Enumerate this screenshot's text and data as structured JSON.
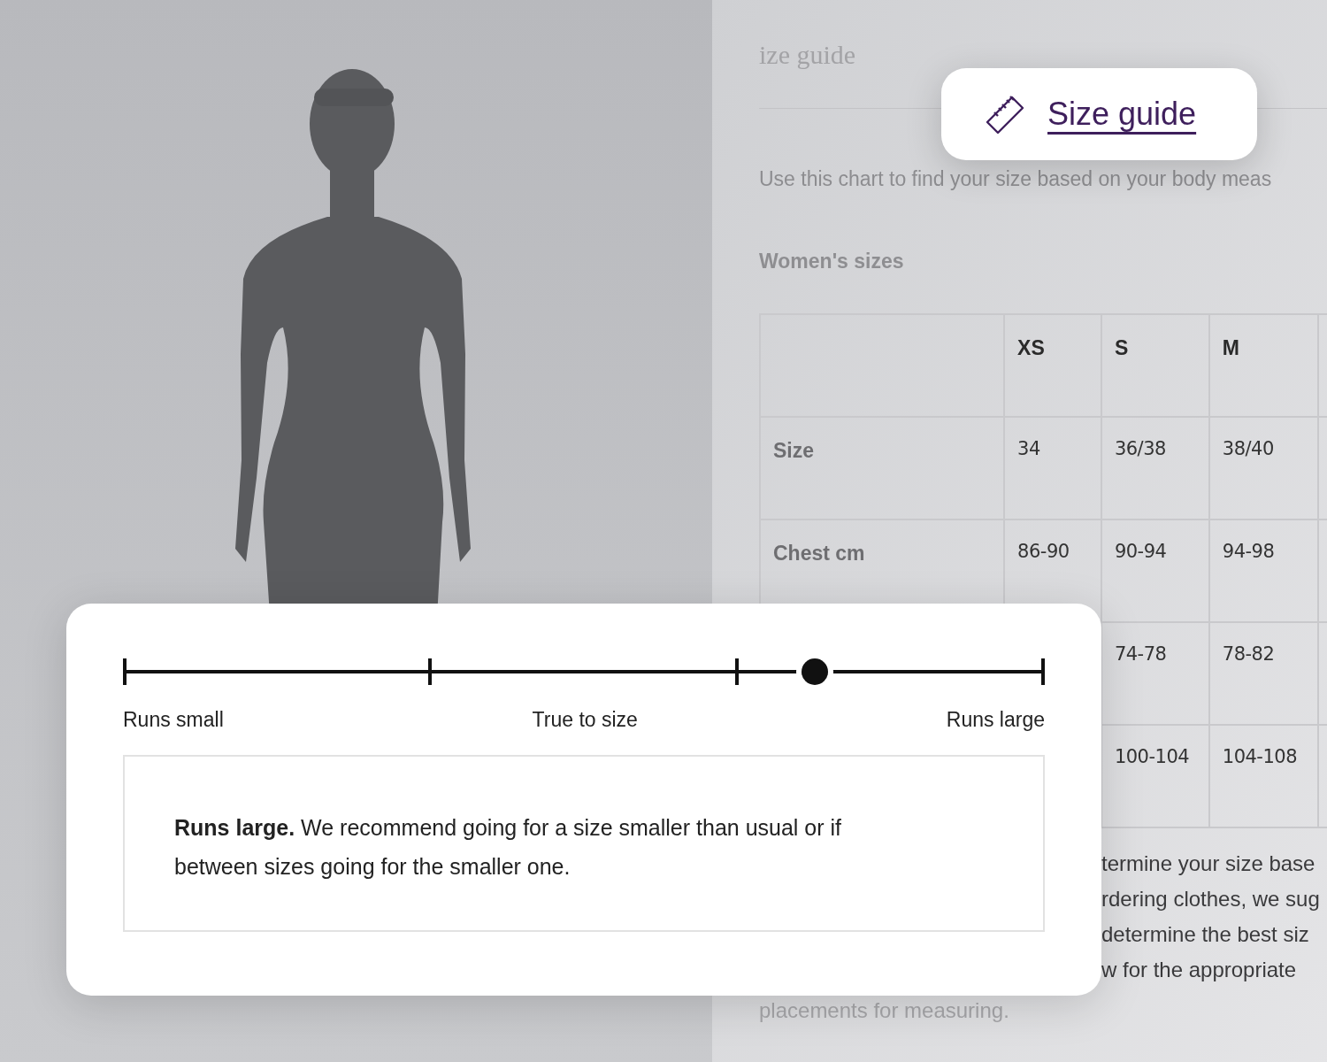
{
  "guide": {
    "title": "ize guide",
    "intro": "Use this chart to find your size based on your body meas",
    "section_title": "Women's sizes"
  },
  "table": {
    "columns": [
      "XS",
      "S",
      "M"
    ],
    "rows": [
      {
        "label": "Size",
        "cells": [
          "34",
          "36/38",
          "38/40"
        ]
      },
      {
        "label": "Chest cm",
        "cells": [
          "86-90",
          "90-94",
          "94-98"
        ]
      },
      {
        "cells": [
          "74-78",
          "78-82"
        ]
      },
      {
        "cells": [
          "100-104",
          "104-108"
        ]
      }
    ]
  },
  "notes": [
    "termine your size base",
    "rdering clothes, we sug",
    "determine the best siz",
    "w for the appropriate",
    "placements for measuring."
  ],
  "size_guide_link": {
    "label": "Size guide"
  },
  "fit": {
    "level": 0.75,
    "labels": [
      "Runs small",
      "True to size",
      "Runs large"
    ],
    "description": "**Runs large.** We recommend going for a size smaller than usual or if between sizes going for the smaller one."
  }
}
